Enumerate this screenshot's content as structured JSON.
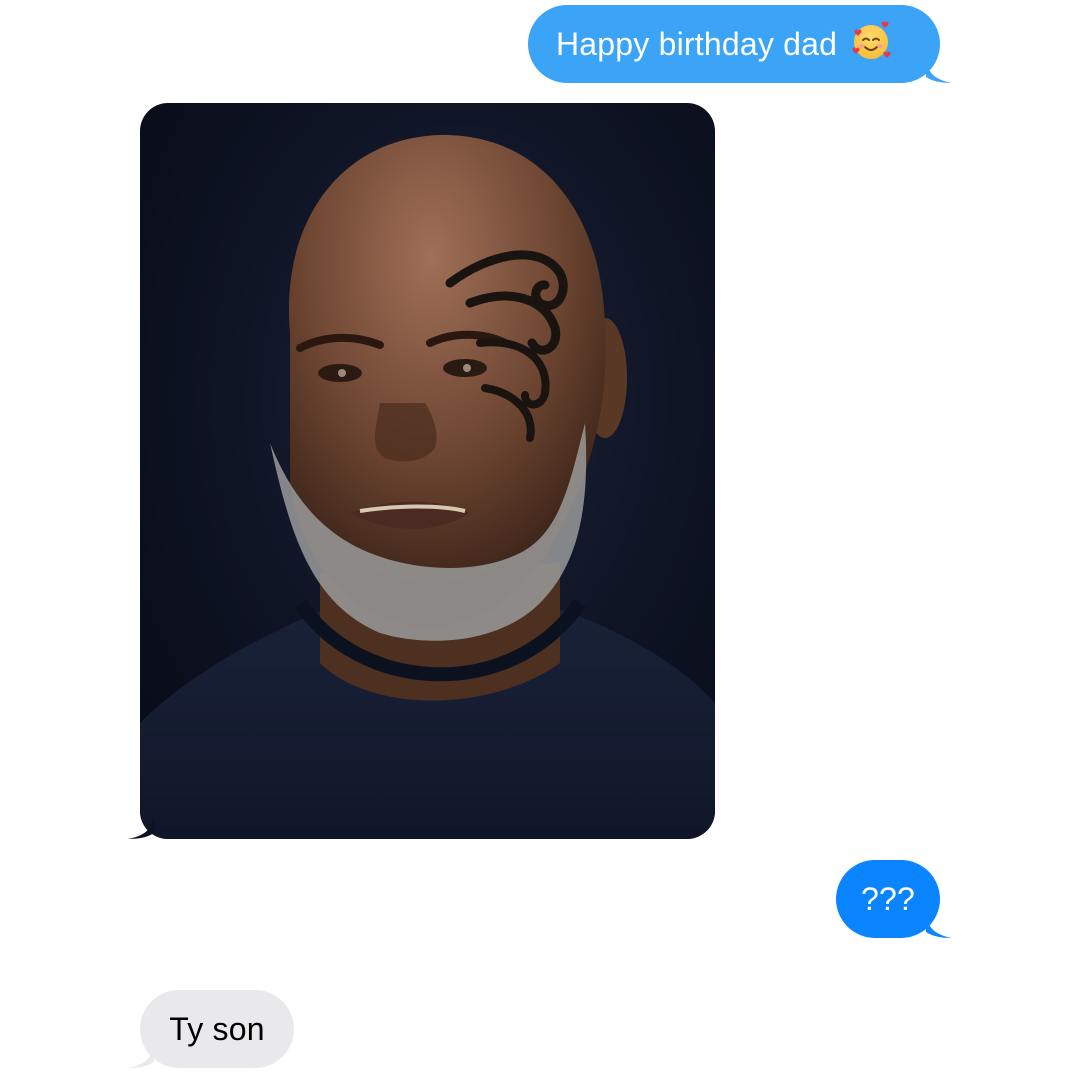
{
  "messages": {
    "sent_1": {
      "text": "Happy birthday dad",
      "emoji": "smiling-face-with-hearts-icon",
      "color": "#3ba4f7"
    },
    "photo": {
      "subject": "portrait-photo",
      "background": "#0d1222"
    },
    "sent_2": {
      "text": "???",
      "color": "#0a84ff"
    },
    "received_1": {
      "text": "Ty son",
      "color": "#e9e9eb"
    }
  }
}
